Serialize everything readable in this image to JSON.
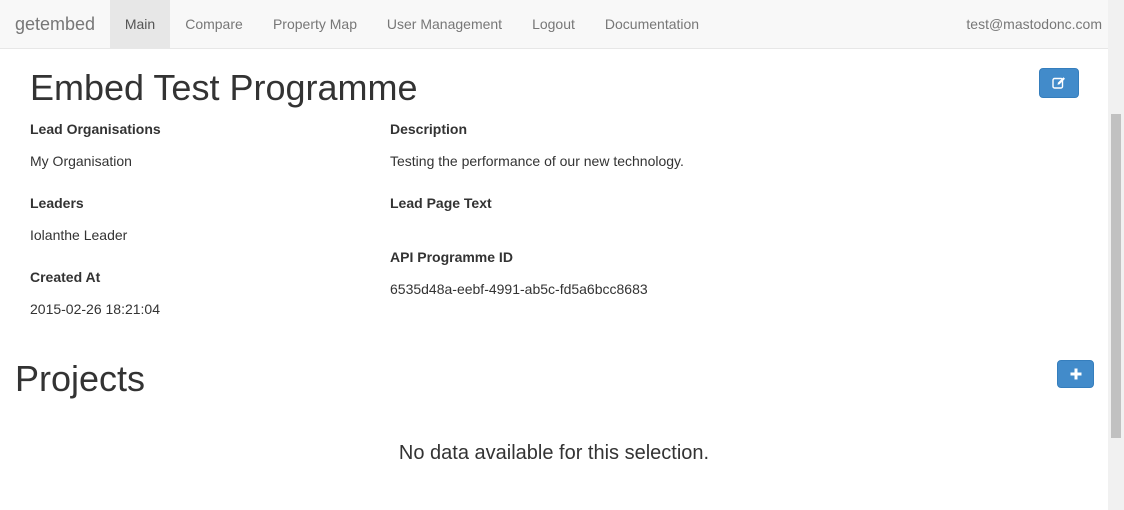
{
  "nav": {
    "brand": "getembed",
    "items": [
      {
        "label": "Main"
      },
      {
        "label": "Compare"
      },
      {
        "label": "Property Map"
      },
      {
        "label": "User Management"
      },
      {
        "label": "Logout"
      },
      {
        "label": "Documentation"
      }
    ],
    "user": "test@mastodonc.com"
  },
  "programme": {
    "title": "Embed Test Programme",
    "lead_orgs_label": "Lead Organisations",
    "lead_orgs_value": "My Organisation",
    "leaders_label": "Leaders",
    "leaders_value": "Iolanthe Leader",
    "created_label": "Created At",
    "created_value": "2015-02-26 18:21:04",
    "description_label": "Description",
    "description_value": "Testing the performance of our new technology.",
    "lead_page_label": "Lead Page Text",
    "lead_page_value": "",
    "api_id_label": "API Programme ID",
    "api_id_value": "6535d48a-eebf-4991-ab5c-fd5a6bcc8683"
  },
  "projects": {
    "title": "Projects",
    "empty": "No data available for this selection."
  },
  "colors": {
    "primary": "#428bca",
    "navbar_bg": "#f8f8f8",
    "active_tab_bg": "#e7e7e7"
  }
}
